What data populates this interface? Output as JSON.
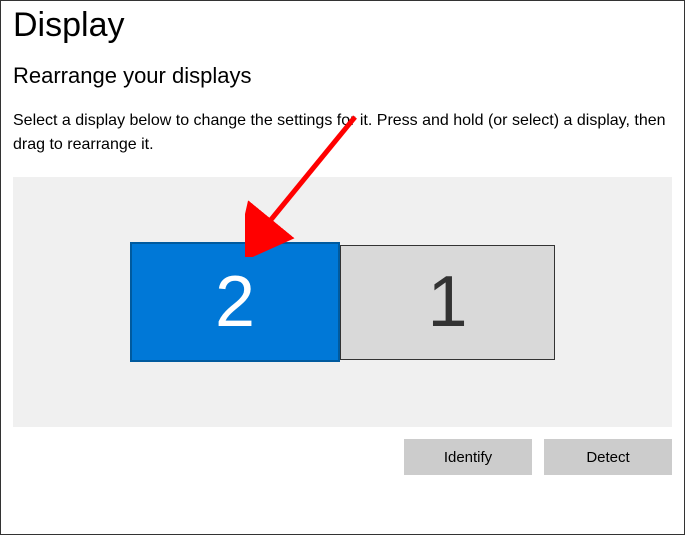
{
  "header": {
    "title": "Display"
  },
  "section": {
    "title": "Rearrange your displays",
    "description": "Select a display below to change the settings for it. Press and hold (or select) a display, then drag to rearrange it."
  },
  "displays": [
    {
      "number": "2",
      "selected": true
    },
    {
      "number": "1",
      "selected": false
    }
  ],
  "buttons": {
    "identify": "Identify",
    "detect": "Detect"
  }
}
